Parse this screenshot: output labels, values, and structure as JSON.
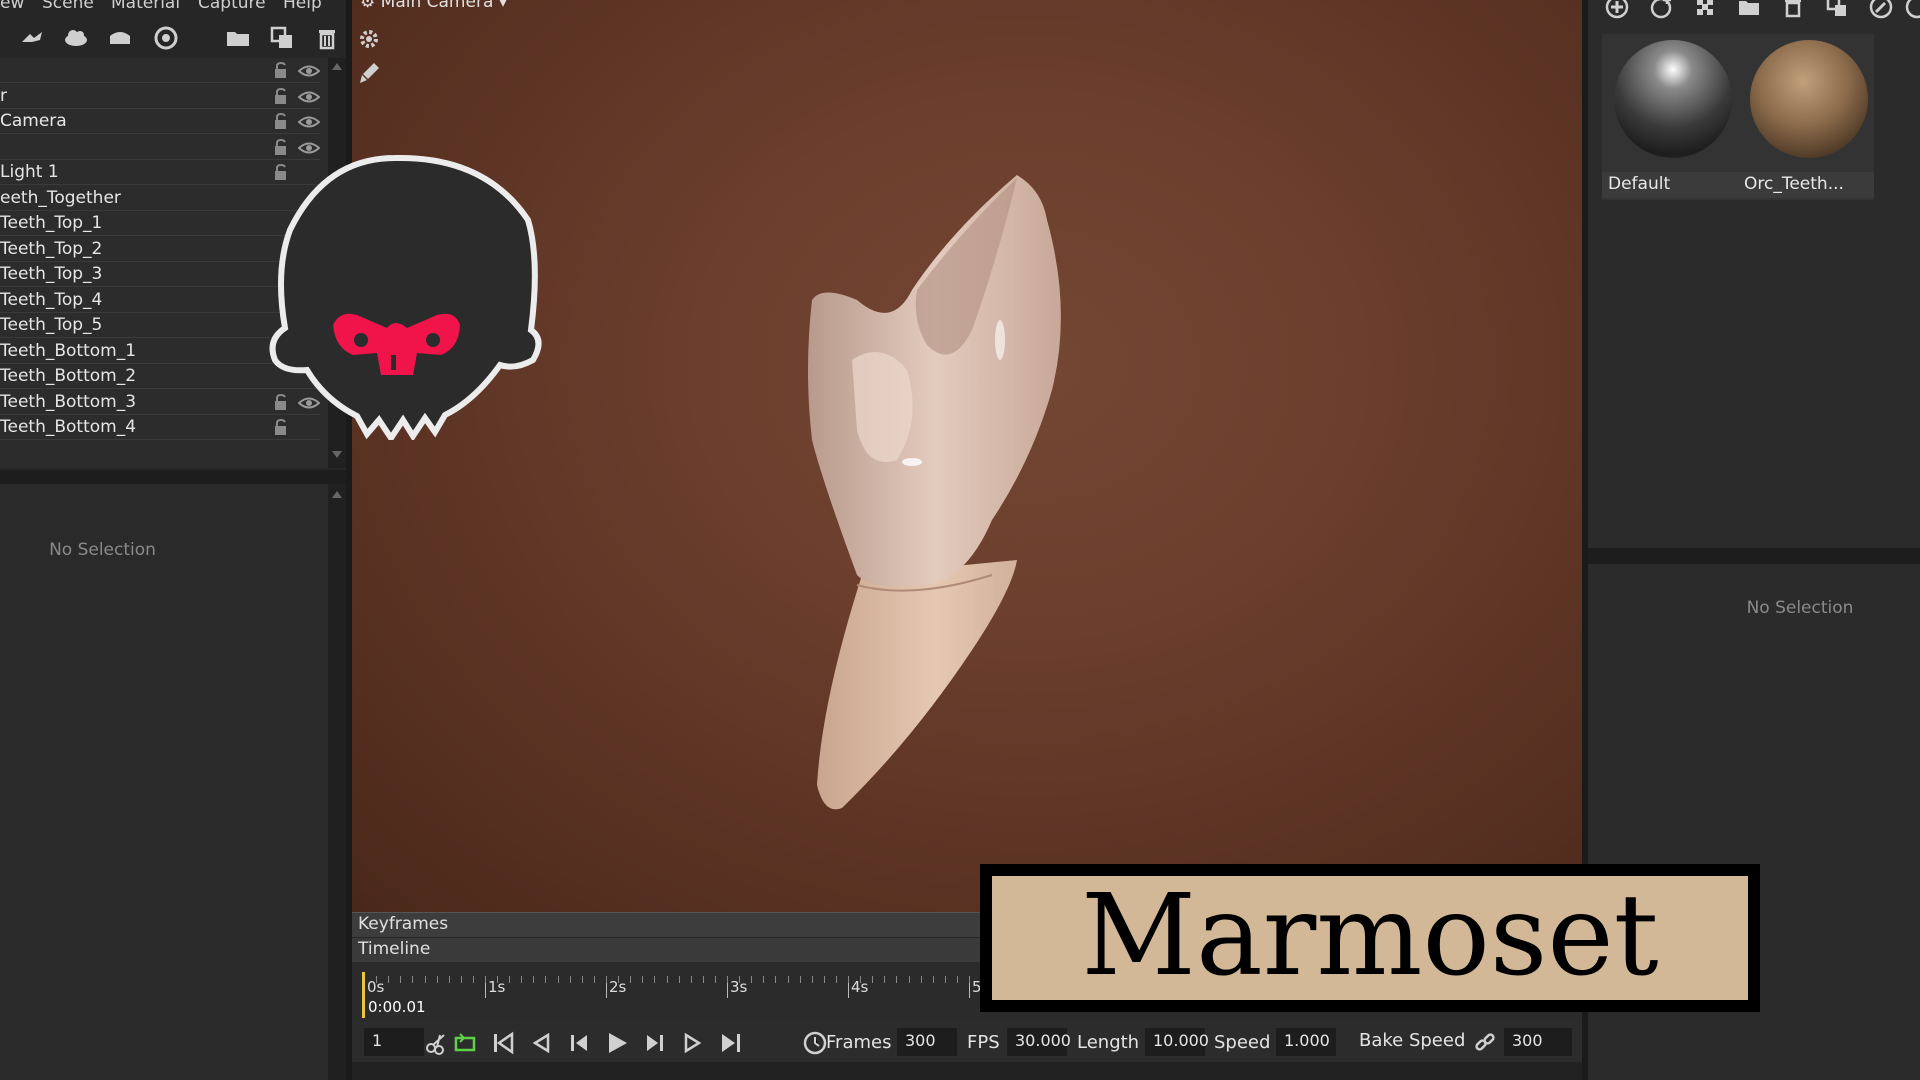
{
  "menubar": {
    "items": [
      "ew",
      "Scene",
      "Material",
      "Capture",
      "Help"
    ]
  },
  "left_toolbar": {
    "icons": [
      "stroke-icon",
      "cloud-icon",
      "hat-icon",
      "target-icon",
      "folder-icon",
      "duplicate-icon",
      "trash-icon"
    ]
  },
  "outliner": {
    "rows": [
      {
        "label": ""
      },
      {
        "label": "r"
      },
      {
        "label": "Camera"
      },
      {
        "label": ""
      },
      {
        "label": "Light 1"
      },
      {
        "label": "eeth_Together"
      },
      {
        "label": "Teeth_Top_1"
      },
      {
        "label": "Teeth_Top_2"
      },
      {
        "label": "Teeth_Top_3"
      },
      {
        "label": "Teeth_Top_4"
      },
      {
        "label": "Teeth_Top_5"
      },
      {
        "label": "Teeth_Bottom_1"
      },
      {
        "label": "Teeth_Bottom_2"
      },
      {
        "label": "Teeth_Bottom_3"
      },
      {
        "label": "Teeth_Bottom_4"
      }
    ]
  },
  "properties_left": {
    "empty_text": "No Selection"
  },
  "viewport": {
    "camera_label": "Main Camera"
  },
  "materials": {
    "items": [
      {
        "name": "Default",
        "color": "#9a9a9a"
      },
      {
        "name": "Orc_Teeth...",
        "color": "#8a6a4a"
      }
    ]
  },
  "properties_right": {
    "empty_text": "No Selection"
  },
  "timeline": {
    "keyframes_label": "Keyframes",
    "timeline_label": "Timeline",
    "ticks": [
      "0s",
      "1s",
      "2s",
      "3s",
      "4s",
      "5"
    ],
    "current_time": "0:00.01",
    "frame_field": "1",
    "frames_label": "Frames",
    "frames_value": "300",
    "fps_label": "FPS",
    "fps_value": "30.000",
    "length_label": "Length",
    "length_value": "10.000",
    "speed_label": "Speed",
    "speed_value": "1.000",
    "bake_speed_label": "Bake Speed",
    "bake_value": "300"
  },
  "overlay": {
    "brand_text": "Marmoset"
  },
  "colors": {
    "viewport_bg": "#6b3e2d",
    "playhead": "#e8c640",
    "logo_accent": "#f0144a",
    "banner_bg": "#d2b896"
  }
}
